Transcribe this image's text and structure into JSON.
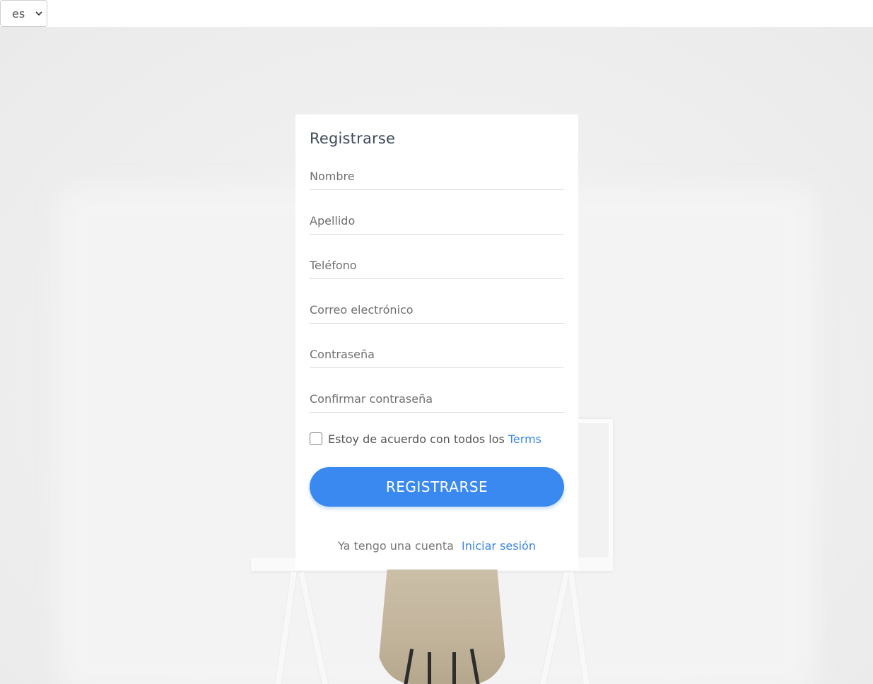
{
  "language_selector": {
    "value": "es"
  },
  "form": {
    "title": "Registrarse",
    "fields": [
      {
        "placeholder": "Nombre"
      },
      {
        "placeholder": "Apellido"
      },
      {
        "placeholder": "Teléfono"
      },
      {
        "placeholder": "Correo electrónico"
      },
      {
        "placeholder": "Contraseña"
      },
      {
        "placeholder": "Confirmar contraseña"
      }
    ],
    "terms": {
      "text": "Estoy de acuerdo con todos los",
      "link": "Terms"
    },
    "submit_label": "REGISTRARSE",
    "login": {
      "text": "Ya tengo una cuenta",
      "link": "Iniciar sesión"
    }
  },
  "colors": {
    "accent": "#3a89f0",
    "link": "#3a86e0",
    "background": "#eeeeee",
    "card": "#ffffff"
  }
}
